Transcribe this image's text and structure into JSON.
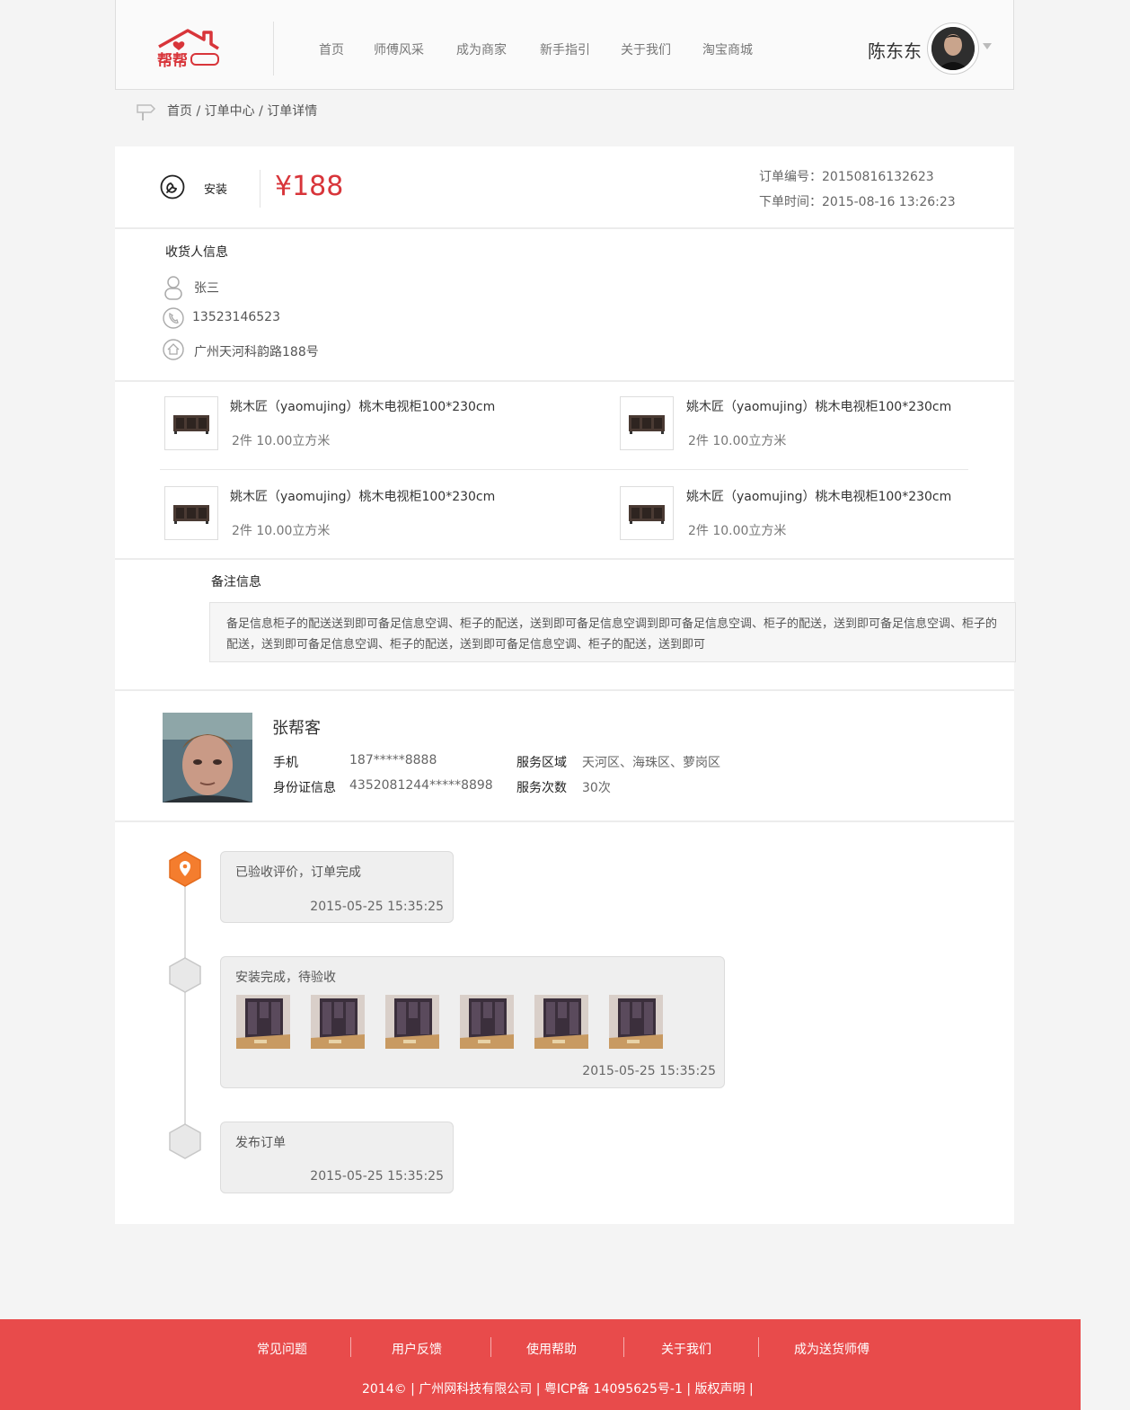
{
  "header": {
    "logo_text": "帮帮",
    "nav": [
      "首页",
      "师傅风采",
      "成为商家",
      "新手指引",
      "关于我们",
      "淘宝商城"
    ],
    "user_name": "陈东东"
  },
  "breadcrumb": "首页 / 订单中心 / 订单详情",
  "order": {
    "service": "安装",
    "price": "¥188",
    "order_no": "订单编号：20150816132623",
    "order_time": "下单时间：2015-08-16 13:26:23"
  },
  "consignee": {
    "title": "收货人信息",
    "name": "张三",
    "phone": "13523146523",
    "address": "广州天河科韵路188号"
  },
  "products": [
    {
      "name": "姚木匠（yaomujing）桃木电视柜100*230cm",
      "qty": "2件  10.00立方米"
    },
    {
      "name": "姚木匠（yaomujing）桃木电视柜100*230cm",
      "qty": "2件  10.00立方米"
    },
    {
      "name": "姚木匠（yaomujing）桃木电视柜100*230cm",
      "qty": "2件  10.00立方米"
    },
    {
      "name": "姚木匠（yaomujing）桃木电视柜100*230cm",
      "qty": "2件  10.00立方米"
    }
  ],
  "remark": {
    "title": "备注信息",
    "text": "备足信息柜子的配送送到即可备足信息空调、柜子的配送，送到即可备足信息空调到即可备足信息空调、柜子的配送，送到即可备足信息空调、柜子的配送，送到即可备足信息空调、柜子的配送，送到即可备足信息空调、柜子的配送，送到即可"
  },
  "worker": {
    "name": "张帮客",
    "phone_label": "手机",
    "phone": "187*****8888",
    "id_label": "身份证信息",
    "id": "4352081244*****8898",
    "area_label": "服务区域",
    "area": "天河区、海珠区、萝岗区",
    "count_label": "服务次数",
    "count": "30次"
  },
  "timeline": [
    {
      "title": "已验收评价，订单完成",
      "time": "2015-05-25 15:35:25",
      "active": true
    },
    {
      "title": "安装完成，待验收",
      "time": "2015-05-25 15:35:25",
      "photos": 6
    },
    {
      "title": "发布订单",
      "time": "2015-05-25 15:35:25"
    }
  ],
  "footer": {
    "links": [
      "常见问题",
      "用户反馈",
      "使用帮助",
      "关于我们",
      "成为送货师傅"
    ],
    "copyright": "2014©  |  广州网科技有限公司  |  粤ICP备 14095625号-1  |  版权声明  |"
  },
  "colors": {
    "brand_red": "#d8353a",
    "footer_red": "#e84b4b",
    "timeline_active": "#f47d2e"
  }
}
